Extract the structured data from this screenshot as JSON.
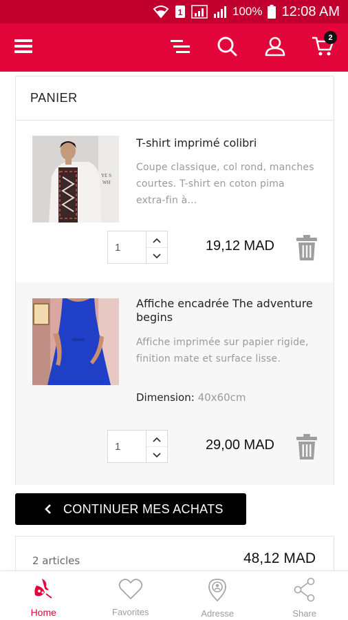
{
  "status_bar": {
    "battery_pct": "100%",
    "time": "12:08 AM",
    "sim": "1"
  },
  "colors": {
    "brand": "#e2063b",
    "status": "#c2002f",
    "button": "#000000",
    "muted": "#9a9a9a"
  },
  "header": {
    "cart_count": "2",
    "icons": [
      "menu-icon",
      "filter-icon",
      "search-icon",
      "user-icon",
      "cart-icon"
    ]
  },
  "cart": {
    "title": "PANIER",
    "items": [
      {
        "name": "T-shirt imprimé colibri",
        "description": "Coupe classique, col rond, manches courtes. T-shirt en coton pima extra-fin à...",
        "quantity": "1",
        "price": "19,12 MAD"
      },
      {
        "name": "Affiche encadrée The adventure begins",
        "description": "Affiche imprimée sur papier rigide, finition mate et surface lisse.",
        "attribute_label": "Dimension:",
        "attribute_value": "40x60cm",
        "quantity": "1",
        "price": "29,00 MAD"
      }
    ],
    "continue_label": "CONTINUER MES ACHATS"
  },
  "summary": {
    "count": "2 articles",
    "total": "48,12 MAD"
  },
  "bottom_nav": [
    {
      "label": "Home",
      "icon": "home-icon",
      "active": true
    },
    {
      "label": "Favorites",
      "icon": "heart-icon",
      "active": false
    },
    {
      "label": "Adresse",
      "icon": "location-icon",
      "active": false
    },
    {
      "label": "Share",
      "icon": "share-icon",
      "active": false
    }
  ]
}
